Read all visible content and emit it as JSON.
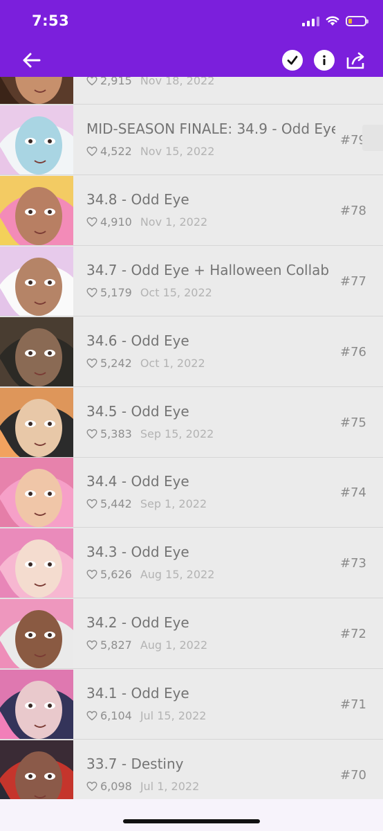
{
  "status": {
    "time": "7:53"
  },
  "colors": {
    "header": "#7b1fdc",
    "background": "#ebebeb",
    "battery": "#f5c518"
  },
  "header": {
    "back_icon": "arrow-left-icon",
    "actions": [
      "checkmark-circle-icon",
      "info-circle-icon",
      "share-icon"
    ]
  },
  "episodes": [
    {
      "title": "",
      "likes": "2,915",
      "date": "Nov 18, 2022",
      "number": "",
      "partial": true
    },
    {
      "title": "MID-SEASON FINALE: 34.9 - Odd Eye",
      "likes": "4,522",
      "date": "Nov 15, 2022",
      "number": "#79"
    },
    {
      "title": "34.8 - Odd Eye",
      "likes": "4,910",
      "date": "Nov 1, 2022",
      "number": "#78"
    },
    {
      "title": "34.7 - Odd Eye + Halloween Collab",
      "likes": "5,179",
      "date": "Oct 15, 2022",
      "number": "#77"
    },
    {
      "title": "34.6 - Odd Eye",
      "likes": "5,242",
      "date": "Oct 1, 2022",
      "number": "#76"
    },
    {
      "title": "34.5 - Odd Eye",
      "likes": "5,383",
      "date": "Sep 15, 2022",
      "number": "#75"
    },
    {
      "title": "34.4 - Odd Eye",
      "likes": "5,442",
      "date": "Sep 1, 2022",
      "number": "#74"
    },
    {
      "title": "34.3 - Odd Eye",
      "likes": "5,626",
      "date": "Aug 15, 2022",
      "number": "#73"
    },
    {
      "title": "34.2 - Odd Eye",
      "likes": "5,827",
      "date": "Aug 1, 2022",
      "number": "#72"
    },
    {
      "title": "34.1 - Odd Eye",
      "likes": "6,104",
      "date": "Jul 15, 2022",
      "number": "#71"
    },
    {
      "title": "33.7 - Destiny",
      "likes": "6,098",
      "date": "Jul 1, 2022",
      "number": "#70"
    }
  ]
}
